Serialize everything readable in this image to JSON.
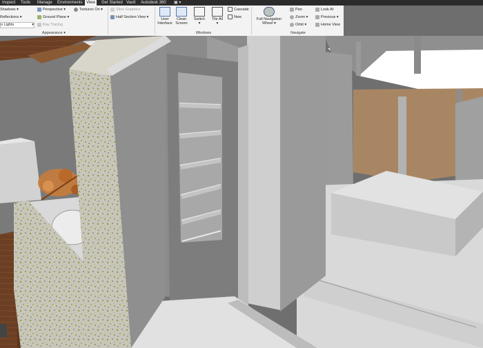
{
  "menu_tabs": [
    "Inspect",
    "Tools",
    "Manage",
    "Environments",
    "View",
    "Get Started",
    "Vault",
    "Autodesk 360"
  ],
  "active_tab": "View",
  "ribbon": {
    "appearance": {
      "shadows": "Shadows",
      "reflections": "Reflections",
      "lights": "o Lights",
      "perspective": "Perspective",
      "ground_plane": "Ground Plane",
      "ray_tracing": "Ray Tracing",
      "textures_on": "Textures On",
      "panel_label": "Appearance"
    },
    "graphics": {
      "slice_graphics": "Slice Graphics",
      "half_section_view": "Half Section View"
    },
    "windows": {
      "user_interface": [
        "User",
        "Interface"
      ],
      "clean_screen": [
        "Clean",
        "Screen"
      ],
      "switch": "Switch",
      "tile_all": "Tile All",
      "cascade": "Cascade",
      "new": "New",
      "panel_label": "Windows"
    },
    "navigate": {
      "full_navigation_wheel": [
        "Full Navigation",
        "Wheel"
      ],
      "pan": "Pan",
      "zoom": "Zoom",
      "orbit": "Orbit",
      "look_at": "Look At",
      "previous": "Previous",
      "home_view": "Home View",
      "panel_label": "Navigate"
    }
  },
  "colors": {
    "menubar": "#2b2b2b",
    "ribbon": "#f3f3f3",
    "wall_grey": "#8e8e8e",
    "floor": "#d6d6d6",
    "wood_panel": "#a98663",
    "speckled_wall": "#c9c6b8",
    "orange_part": "#c87c3a"
  }
}
